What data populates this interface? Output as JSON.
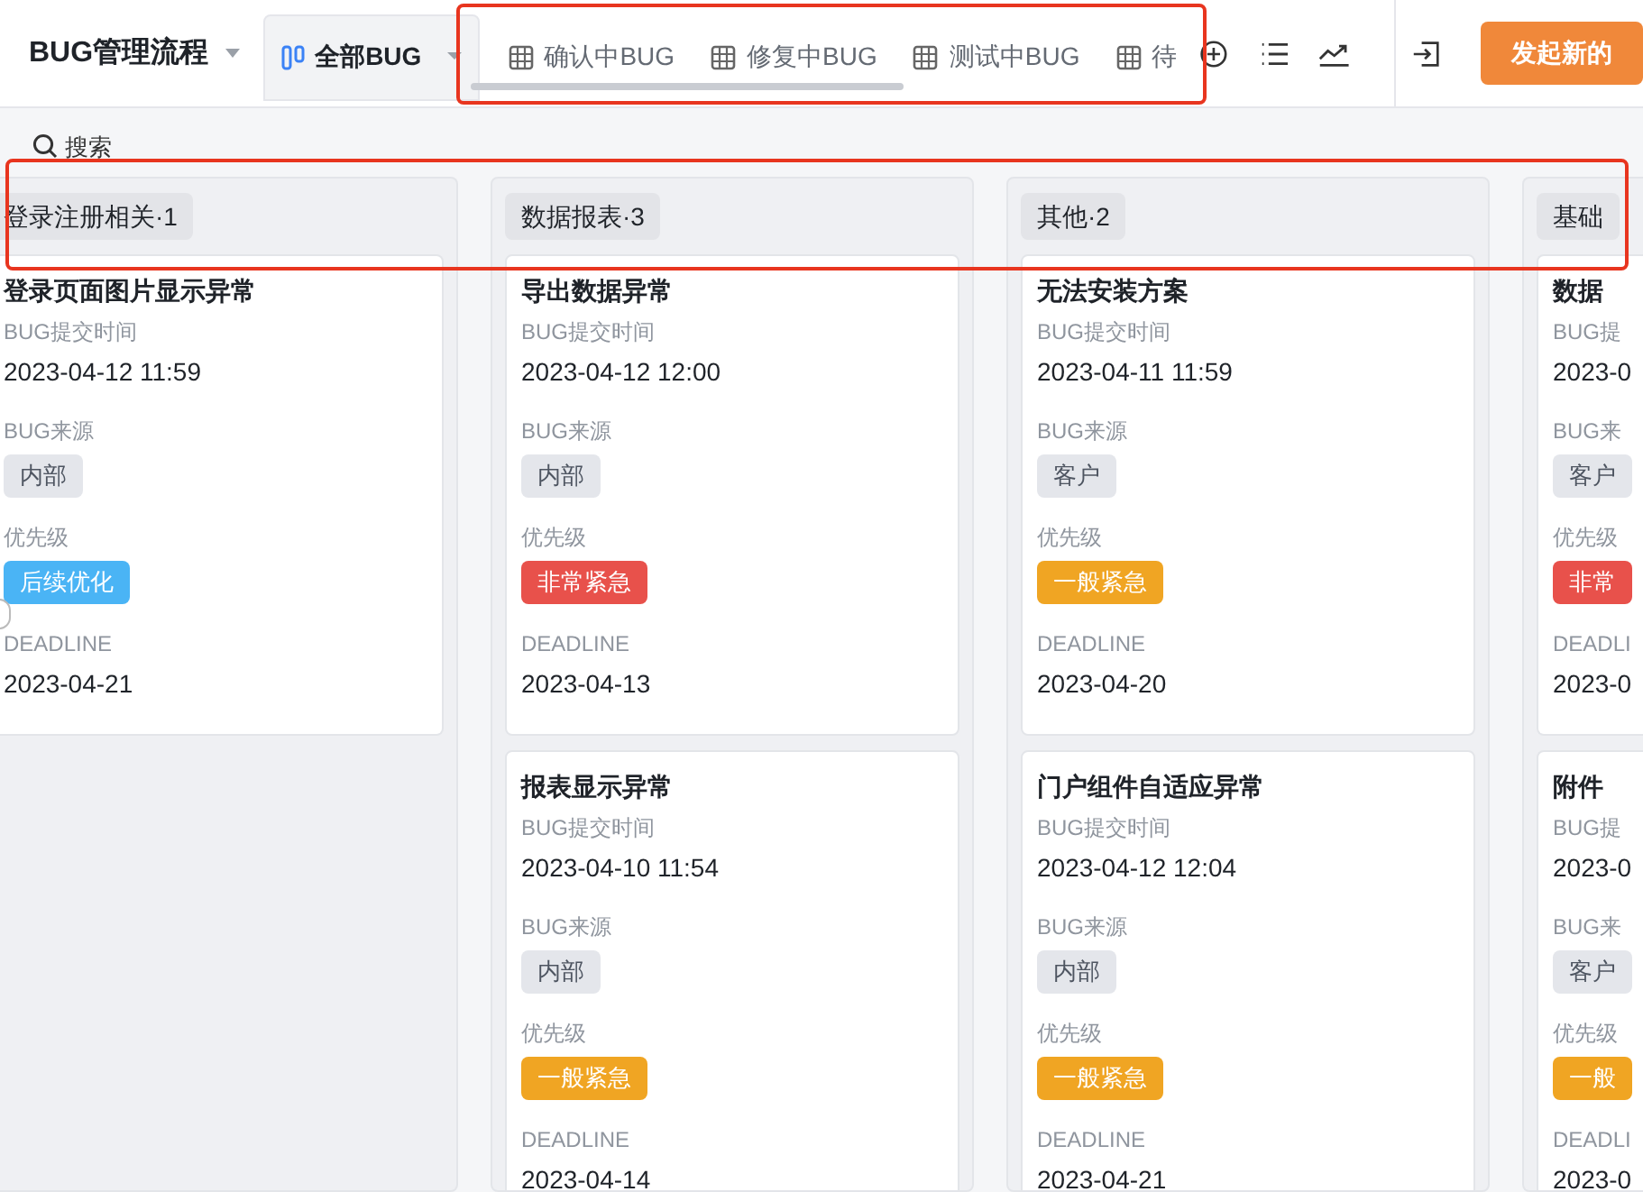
{
  "app": {
    "title": "BUG管理流程"
  },
  "view_tabs": {
    "highlighted": true,
    "items": [
      {
        "label": "全部BUG",
        "selected": true,
        "kind": "board"
      },
      {
        "label": "确认中BUG",
        "selected": false,
        "kind": "table"
      },
      {
        "label": "修复中BUG",
        "selected": false,
        "kind": "table"
      },
      {
        "label": "测试中BUG",
        "selected": false,
        "kind": "table"
      },
      {
        "label": "待",
        "selected": false,
        "kind": "table"
      }
    ]
  },
  "toolbar": {
    "primary_button": "发起新的"
  },
  "search": {
    "placeholder": "搜索"
  },
  "board": {
    "header_highlighted": true,
    "columns": [
      {
        "title": "登录注册相关·1",
        "cards": [
          {
            "title": "登录页面图片显示异常",
            "fields": [
              {
                "kind": "text",
                "label": "BUG提交时间",
                "value": "2023-04-12 11:59"
              },
              {
                "kind": "tag",
                "label": "BUG来源",
                "value": "内部",
                "color": "#e4e6eb"
              },
              {
                "kind": "tag",
                "label": "优先级",
                "value": "后续优化",
                "color": "#4ab4f5"
              },
              {
                "kind": "text",
                "label": "DEADLINE",
                "value": "2023-04-21"
              }
            ]
          }
        ]
      },
      {
        "title": "数据报表·3",
        "cards": [
          {
            "title": "导出数据异常",
            "fields": [
              {
                "kind": "text",
                "label": "BUG提交时间",
                "value": "2023-04-12 12:00"
              },
              {
                "kind": "tag",
                "label": "BUG来源",
                "value": "内部",
                "color": "#e4e6eb"
              },
              {
                "kind": "tag",
                "label": "优先级",
                "value": "非常紧急",
                "color": "#e8514b"
              },
              {
                "kind": "text",
                "label": "DEADLINE",
                "value": "2023-04-13"
              }
            ]
          },
          {
            "title": "报表显示异常",
            "fields": [
              {
                "kind": "text",
                "label": "BUG提交时间",
                "value": "2023-04-10 11:54"
              },
              {
                "kind": "tag",
                "label": "BUG来源",
                "value": "内部",
                "color": "#e4e6eb"
              },
              {
                "kind": "tag",
                "label": "优先级",
                "value": "一般紧急",
                "color": "#f0a523"
              },
              {
                "kind": "text",
                "label": "DEADLINE",
                "value": "2023-04-14"
              }
            ]
          }
        ]
      },
      {
        "title": "其他·2",
        "cards": [
          {
            "title": "无法安装方案",
            "fields": [
              {
                "kind": "text",
                "label": "BUG提交时间",
                "value": "2023-04-11 11:59"
              },
              {
                "kind": "tag",
                "label": "BUG来源",
                "value": "客户",
                "color": "#e4e6eb"
              },
              {
                "kind": "tag",
                "label": "优先级",
                "value": "一般紧急",
                "color": "#f0a523"
              },
              {
                "kind": "text",
                "label": "DEADLINE",
                "value": "2023-04-20"
              }
            ]
          },
          {
            "title": "门户组件自适应异常",
            "fields": [
              {
                "kind": "text",
                "label": "BUG提交时间",
                "value": "2023-04-12 12:04"
              },
              {
                "kind": "tag",
                "label": "BUG来源",
                "value": "内部",
                "color": "#e4e6eb"
              },
              {
                "kind": "tag",
                "label": "优先级",
                "value": "一般紧急",
                "color": "#f0a523"
              },
              {
                "kind": "text",
                "label": "DEADLINE",
                "value": "2023-04-21"
              }
            ]
          }
        ]
      },
      {
        "title": "基础",
        "cards": [
          {
            "title": "数据",
            "fields": [
              {
                "kind": "text",
                "label": "BUG提",
                "value": "2023-0"
              },
              {
                "kind": "tag",
                "label": "BUG来",
                "value": "客户",
                "color": "#e4e6eb"
              },
              {
                "kind": "tag",
                "label": "优先级",
                "value": "非常",
                "color": "#e8514b"
              },
              {
                "kind": "text",
                "label": "DEADLI",
                "value": "2023-0"
              }
            ]
          },
          {
            "title": "附件",
            "fields": [
              {
                "kind": "text",
                "label": "BUG提",
                "value": "2023-0"
              },
              {
                "kind": "tag",
                "label": "BUG来",
                "value": "客户",
                "color": "#e4e6eb"
              },
              {
                "kind": "tag",
                "label": "优先级",
                "value": "一般",
                "color": "#f0a523"
              },
              {
                "kind": "text",
                "label": "DEADLI",
                "value": "2023-0"
              }
            ]
          }
        ]
      }
    ]
  }
}
